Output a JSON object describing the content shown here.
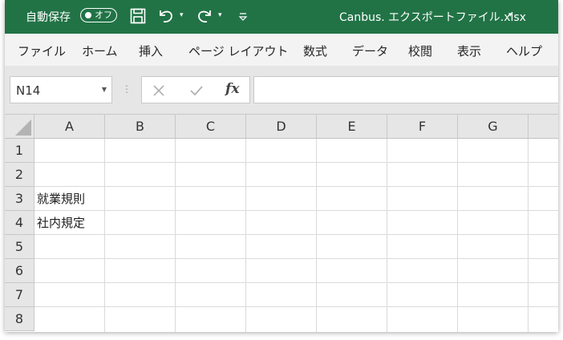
{
  "titlebar": {
    "autosave_label": "自動保存",
    "autosave_state": "オフ",
    "file_name": "Canbus. エクスポートファイル.xlsx",
    "dropdown_glyph": "▾",
    "more_glyph": "▿"
  },
  "ribbon": {
    "tabs": [
      "ファイル",
      "ホーム",
      "挿入",
      "ページ レイアウト",
      "数式",
      "データ",
      "校閲",
      "表示",
      "ヘルプ"
    ]
  },
  "formula_bar": {
    "name_box": "N14",
    "dropdown_glyph": "▼",
    "separator": "⋮",
    "fx_label": "fx",
    "formula": ""
  },
  "grid": {
    "columns": [
      "A",
      "B",
      "C",
      "D",
      "E",
      "F",
      "G"
    ],
    "rows": [
      "1",
      "2",
      "3",
      "4",
      "5",
      "6",
      "7",
      "8"
    ],
    "cells": {
      "A3": "就業規則",
      "A4": "社内規定"
    }
  },
  "colors": {
    "titlebar": "#217346",
    "ribbon": "#f3f3f3",
    "header": "#e6e6e6",
    "gridline": "#dadada"
  },
  "icons": [
    "save-icon",
    "undo-icon",
    "redo-icon",
    "cancel-icon",
    "enter-icon",
    "fx-icon"
  ]
}
